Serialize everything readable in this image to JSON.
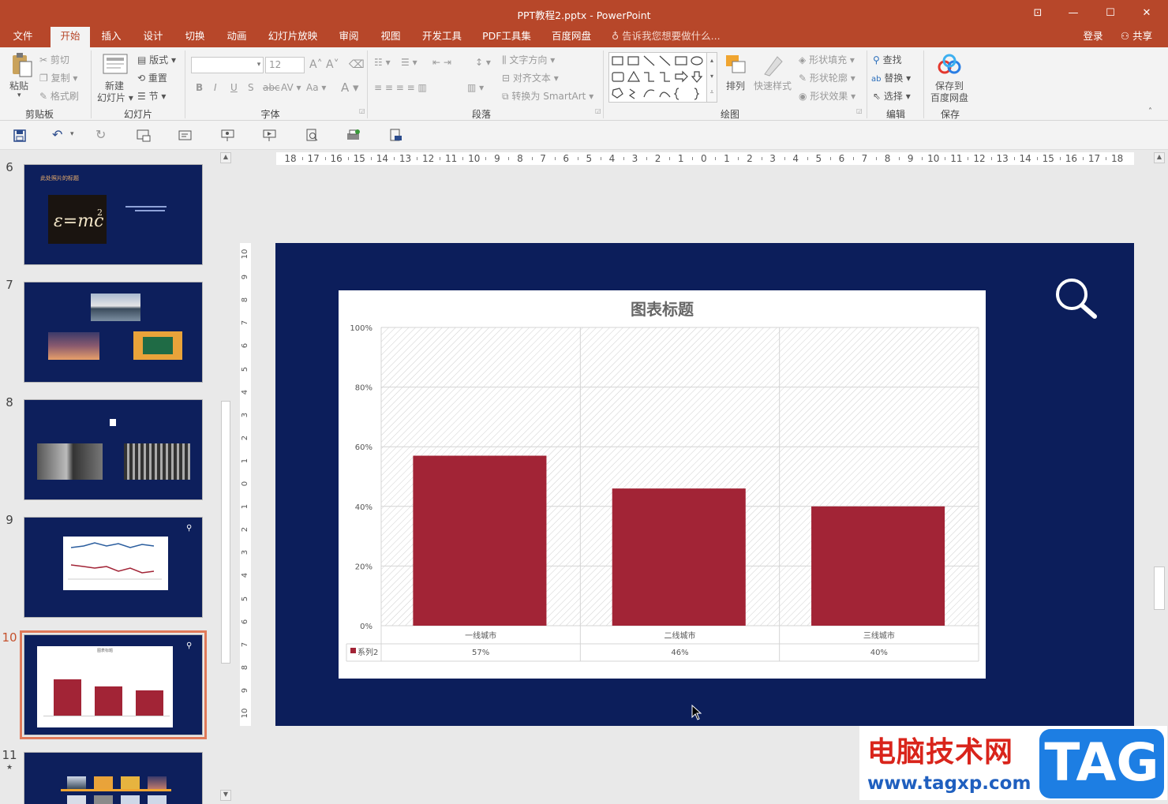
{
  "window": {
    "title": "PPT教程2.pptx - PowerPoint"
  },
  "tabs": [
    "文件",
    "开始",
    "插入",
    "设计",
    "切换",
    "动画",
    "幻灯片放映",
    "审阅",
    "视图",
    "开发工具",
    "PDF工具集",
    "百度网盘"
  ],
  "tellme": "告诉我您想要做什么...",
  "login": "登录",
  "share": "共享",
  "ribbon": {
    "clipboard": {
      "paste": "粘贴",
      "cut": "剪切",
      "copy": "复制",
      "format_painter": "格式刷",
      "label": "剪贴板"
    },
    "slides": {
      "new_slide": "新建",
      "new_slide2": "幻灯片",
      "layout": "版式",
      "reset": "重置",
      "section": "节",
      "label": "幻灯片"
    },
    "font": {
      "size": "12",
      "label": "字体"
    },
    "paragraph": {
      "text_direction": "文字方向",
      "align_text": "对齐文本",
      "smartart": "转换为 SmartArt",
      "label": "段落"
    },
    "drawing": {
      "arrange": "排列",
      "quick_styles": "快速样式",
      "shape_fill": "形状填充",
      "shape_outline": "形状轮廓",
      "shape_effects": "形状效果",
      "label": "绘图"
    },
    "editing": {
      "find": "查找",
      "replace": "替换",
      "select": "选择",
      "label": "编辑"
    },
    "save": {
      "save_to": "保存到",
      "baidu": "百度网盘",
      "label": "保存"
    }
  },
  "thumbnails": [
    {
      "num": "6",
      "title": "此处照片的标题"
    },
    {
      "num": "7"
    },
    {
      "num": "8"
    },
    {
      "num": "9"
    },
    {
      "num": "10",
      "selected": true,
      "title": "图表标题"
    },
    {
      "num": "11",
      "star": "★"
    }
  ],
  "ruler": {
    "h": [
      "18",
      "17",
      "16",
      "15",
      "14",
      "13",
      "12",
      "11",
      "10",
      "9",
      "8",
      "7",
      "6",
      "5",
      "4",
      "3",
      "2",
      "1",
      "0",
      "1",
      "2",
      "3",
      "4",
      "5",
      "6",
      "7",
      "8",
      "9",
      "10",
      "11",
      "12",
      "13",
      "14",
      "15",
      "16",
      "17",
      "18"
    ],
    "v": [
      "10",
      "9",
      "8",
      "7",
      "6",
      "5",
      "4",
      "3",
      "2",
      "1",
      "0",
      "1",
      "2",
      "3",
      "4",
      "5",
      "6",
      "7",
      "8",
      "9",
      "10"
    ]
  },
  "chart_data": {
    "type": "bar",
    "title": "图表标题",
    "categories": [
      "一线城市",
      "二线城市",
      "三线城市"
    ],
    "series": [
      {
        "name": "系列2",
        "values": [
          57,
          46,
          40
        ],
        "labels": [
          "57%",
          "46%",
          "40%"
        ],
        "color": "#a22436"
      }
    ],
    "ylim": [
      0,
      100
    ],
    "yticks": [
      "0%",
      "20%",
      "40%",
      "60%",
      "80%",
      "100%"
    ],
    "grid": true
  },
  "watermark": {
    "cn": "电脑技术网",
    "url": "www.tagxp.com",
    "tag": "TAG"
  }
}
